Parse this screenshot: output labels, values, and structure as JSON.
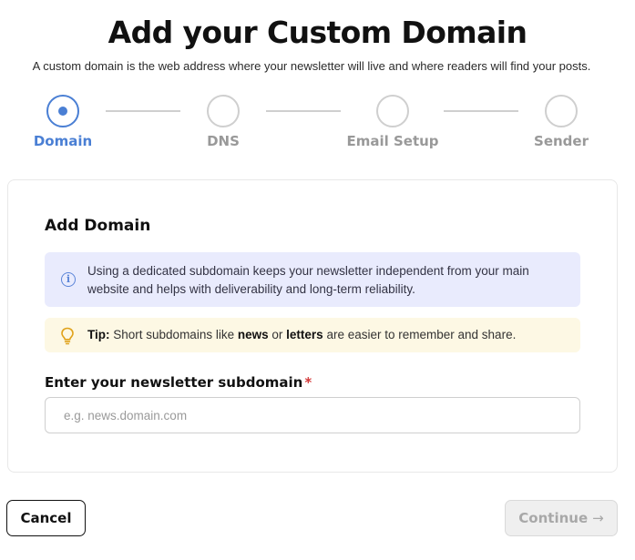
{
  "header": {
    "title": "Add your Custom Domain",
    "subtitle": "A custom domain is the web address where your newsletter will live and where readers will find your posts."
  },
  "stepper": {
    "steps": [
      {
        "label": "Domain",
        "state": "active"
      },
      {
        "label": "DNS",
        "state": "pending"
      },
      {
        "label": "Email Setup",
        "state": "pending"
      },
      {
        "label": "Sender",
        "state": "pending"
      }
    ],
    "active_color": "#4a7fd4",
    "inactive_color": "#cfcfcf"
  },
  "card": {
    "title": "Add Domain",
    "info": {
      "icon": "info-icon",
      "text": "Using a dedicated subdomain keeps your newsletter independent from your main website and helps with deliverability and long-term reliability."
    },
    "tip": {
      "icon": "lightbulb-icon",
      "prefix": "Tip:",
      "text_before": "Short subdomains like",
      "example_1": "news",
      "text_between": "or",
      "example_2": "letters",
      "text_after": "are easier to remember and share."
    },
    "field": {
      "label": "Enter your newsletter subdomain",
      "required_mark": "*",
      "placeholder": "e.g. news.domain.com",
      "value": ""
    }
  },
  "footer": {
    "cancel_label": "Cancel",
    "continue_label": "Continue",
    "continue_icon": "arrow-right-icon",
    "continue_disabled": true
  }
}
